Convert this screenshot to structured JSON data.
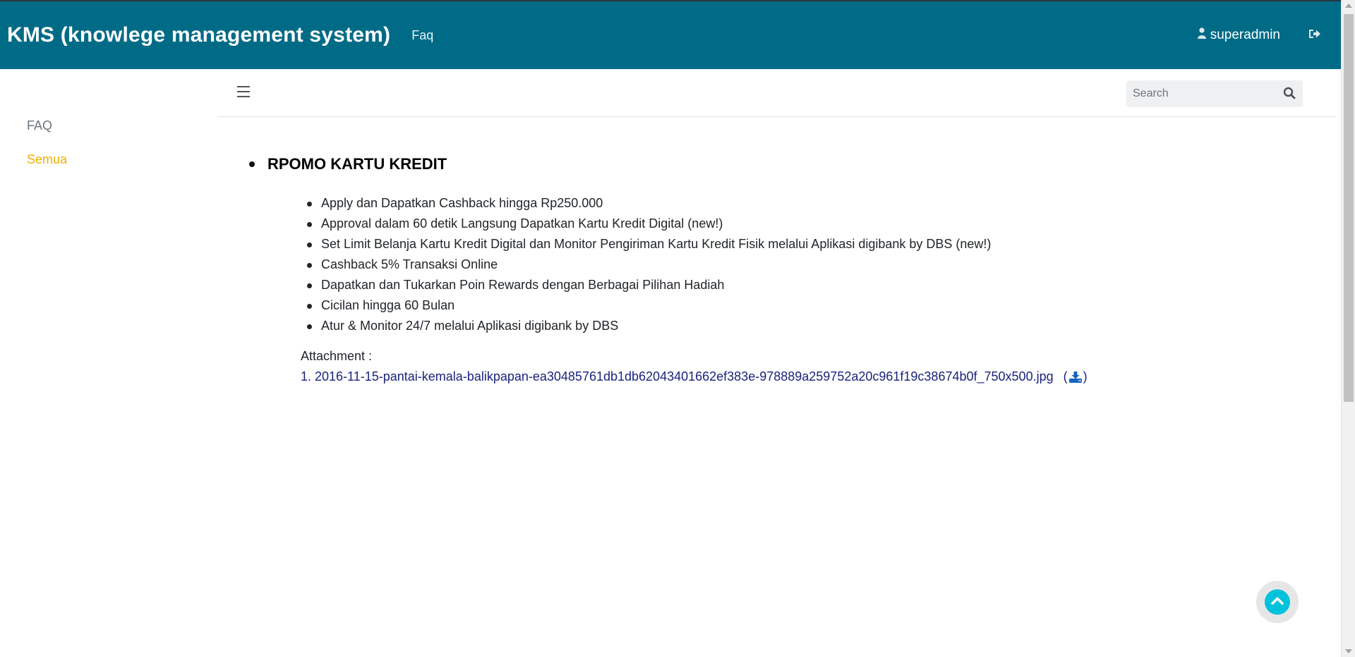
{
  "navbar": {
    "brand": "KMS (knowlege management system)",
    "faq_link": "Faq",
    "username": "superadmin",
    "icons": {
      "user": "user-icon",
      "logout": "sign-out-icon"
    },
    "bg_color": "#006b87"
  },
  "sidebar": {
    "items": [
      {
        "label": "FAQ",
        "color": "#6c757d"
      },
      {
        "label": "Semua",
        "color": "#f0b000",
        "active": true
      }
    ]
  },
  "toolbar": {
    "menu_icon": "hamburger-icon",
    "search": {
      "placeholder": "Search",
      "value": "",
      "icon": "search-icon"
    }
  },
  "faq": {
    "title": "RPOMO KARTU KREDIT",
    "points": [
      "Apply dan Dapatkan Cashback hingga Rp250.000",
      "Approval dalam 60 detik Langsung Dapatkan Kartu Kredit Digital (new!)",
      "Set Limit Belanja Kartu Kredit Digital dan Monitor Pengiriman Kartu Kredit Fisik melalui Aplikasi digibank by DBS (new!)",
      "Cashback 5% Transaksi Online",
      "Dapatkan dan Tukarkan Poin Rewards dengan Berbagai Pilihan Hadiah",
      "Cicilan hingga 60 Bulan",
      "Atur & Monitor 24/7 melalui Aplikasi digibank by DBS"
    ],
    "attachment_label": "Attachment :",
    "attachments": [
      {
        "name": "1. 2016-11-15-pantai-kemala-balikpapan-ea30485761db1db62043401662ef383e-978889a259752a20c961f19c38674b0f_750x500.jpg",
        "open_paren": "(",
        "close_paren": ")",
        "icon": "download-icon"
      }
    ]
  },
  "back_to_top": {
    "icon": "chevron-up-icon",
    "color": "#00c2dc"
  }
}
